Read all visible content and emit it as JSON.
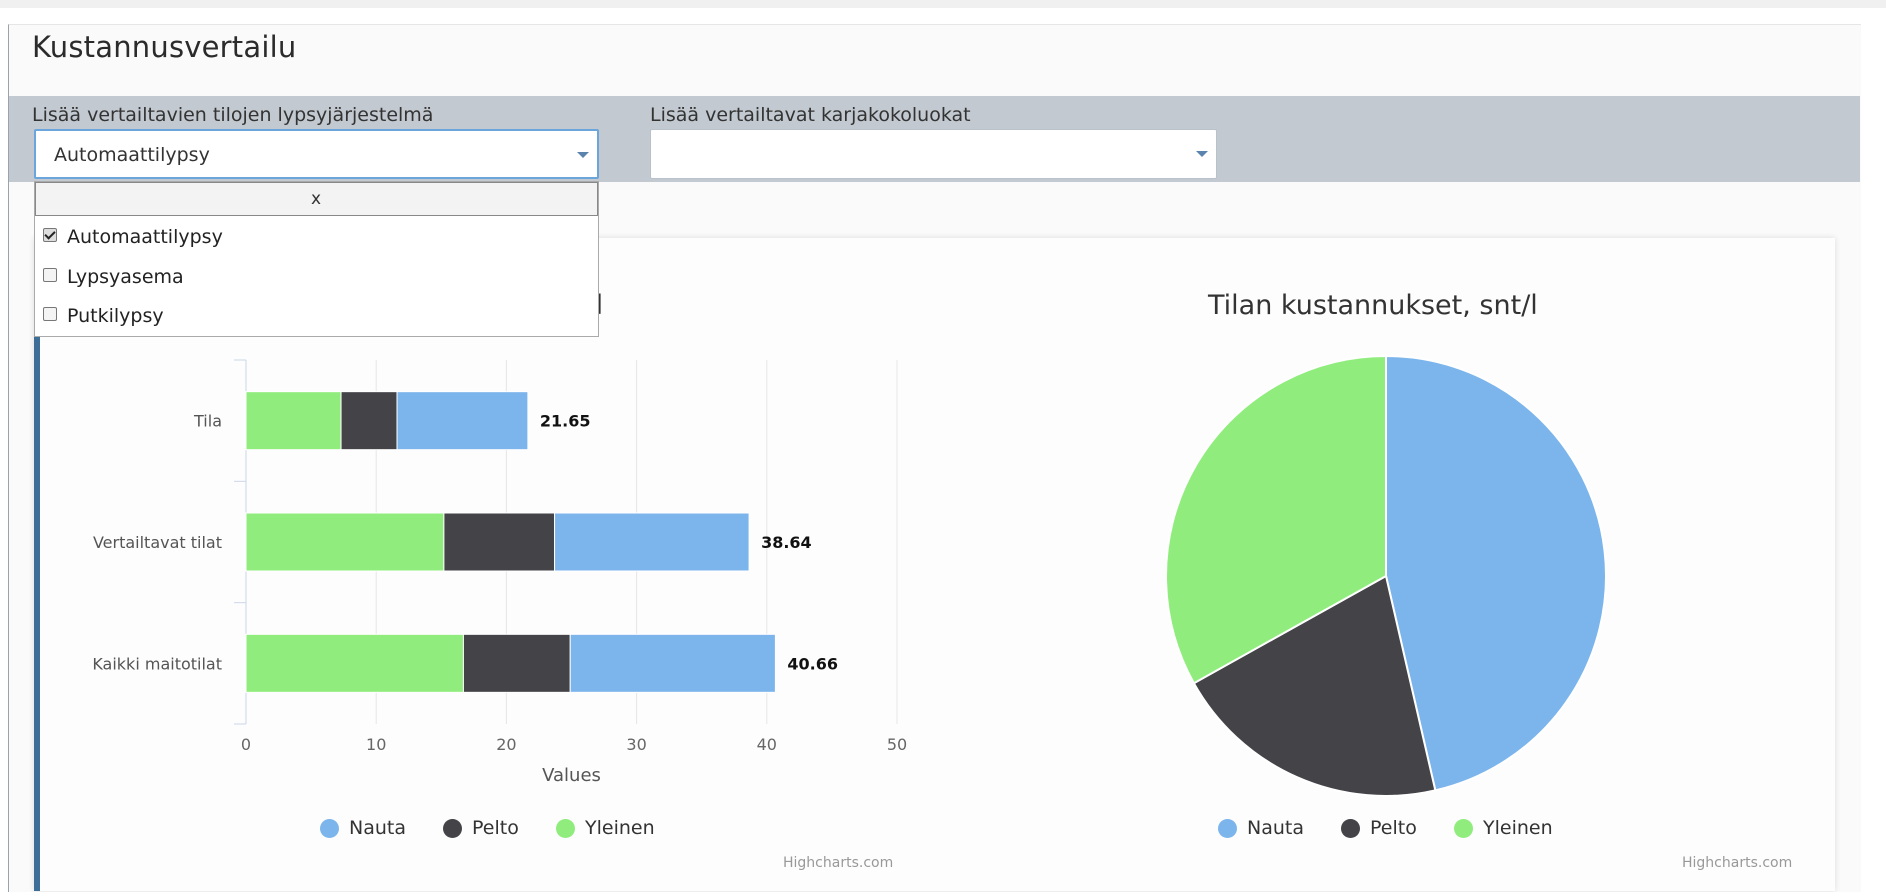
{
  "page": {
    "title": "Kustannusvertailu"
  },
  "filters": {
    "milking_system": {
      "label": "Lisää vertailtavien tilojen lypsyjärjestelmä",
      "selected": "Automaattilypsy",
      "close_label": "x",
      "options": [
        {
          "label": "Automaattilypsy",
          "checked": true
        },
        {
          "label": "Lypsyasema",
          "checked": false
        },
        {
          "label": "Putkilypsy",
          "checked": false
        }
      ]
    },
    "herd_size": {
      "label": "Lisää vertailtavat karjakokoluokat",
      "selected": ""
    }
  },
  "colors": {
    "nauta": "#7cb5ec",
    "pelto": "#434348",
    "yleinen": "#90ed7d",
    "accent": "#3c6e98"
  },
  "chart_data": [
    {
      "type": "bar",
      "stacked": true,
      "title": "t/l",
      "categories": [
        "Tila",
        "Vertailtavat tilat",
        "Kaikki maitotilat"
      ],
      "series": [
        {
          "name": "Yleinen",
          "values": [
            7.3,
            15.2,
            16.7
          ]
        },
        {
          "name": "Pelto",
          "values": [
            4.3,
            8.5,
            8.2
          ]
        },
        {
          "name": "Nauta",
          "values": [
            10.05,
            14.94,
            15.76
          ]
        }
      ],
      "totals": [
        "21.65",
        "38.64",
        "40.66"
      ],
      "xlabel": "Values",
      "xlim": [
        0,
        50
      ],
      "ticks": [
        "0",
        "10",
        "20",
        "30",
        "40",
        "50"
      ],
      "legend": [
        "Nauta",
        "Pelto",
        "Yleinen"
      ],
      "credit": "Highcharts.com"
    },
    {
      "type": "pie",
      "title": "Tilan kustannukset, snt/l",
      "labels": [
        "Nauta",
        "Pelto",
        "Yleinen"
      ],
      "values": [
        46.4,
        20.5,
        33.1
      ],
      "legend": [
        "Nauta",
        "Pelto",
        "Yleinen"
      ],
      "credit": "Highcharts.com"
    }
  ]
}
